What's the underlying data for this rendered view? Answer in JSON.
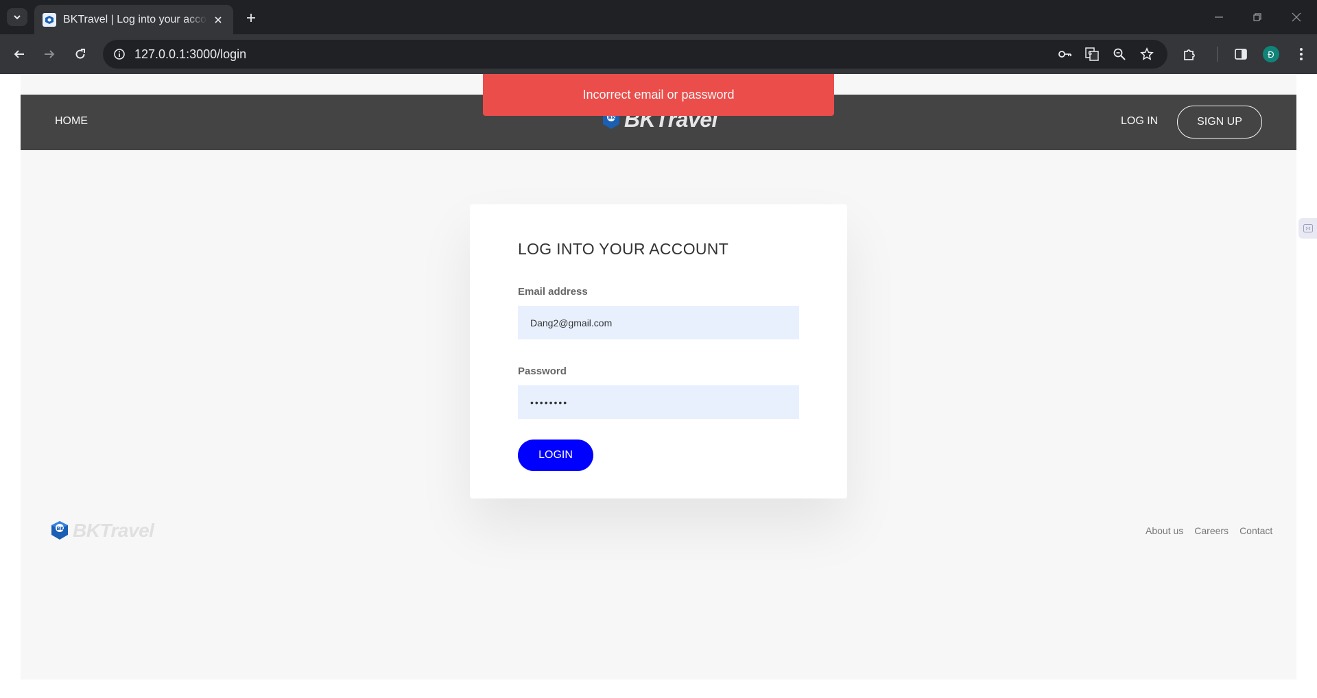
{
  "browser": {
    "tab_title": "BKTravel | Log into your account",
    "url": "127.0.0.1:3000/login",
    "profile_initial": "Đ"
  },
  "header": {
    "home": "HOME",
    "brand": "BKTravel",
    "login": "LOG IN",
    "signup": "SIGN UP"
  },
  "alert": {
    "message": "Incorrect email or password",
    "color": "#eb4d4b"
  },
  "form": {
    "title": "LOG INTO YOUR ACCOUNT",
    "email_label": "Email address",
    "email_value": "Dang2@gmail.com",
    "password_label": "Password",
    "password_value": "••••••••",
    "submit": "LOGIN",
    "accent": "#0000ff"
  },
  "footer": {
    "brand": "BKTravel",
    "links": [
      "About us",
      "Careers",
      "Contact"
    ]
  }
}
